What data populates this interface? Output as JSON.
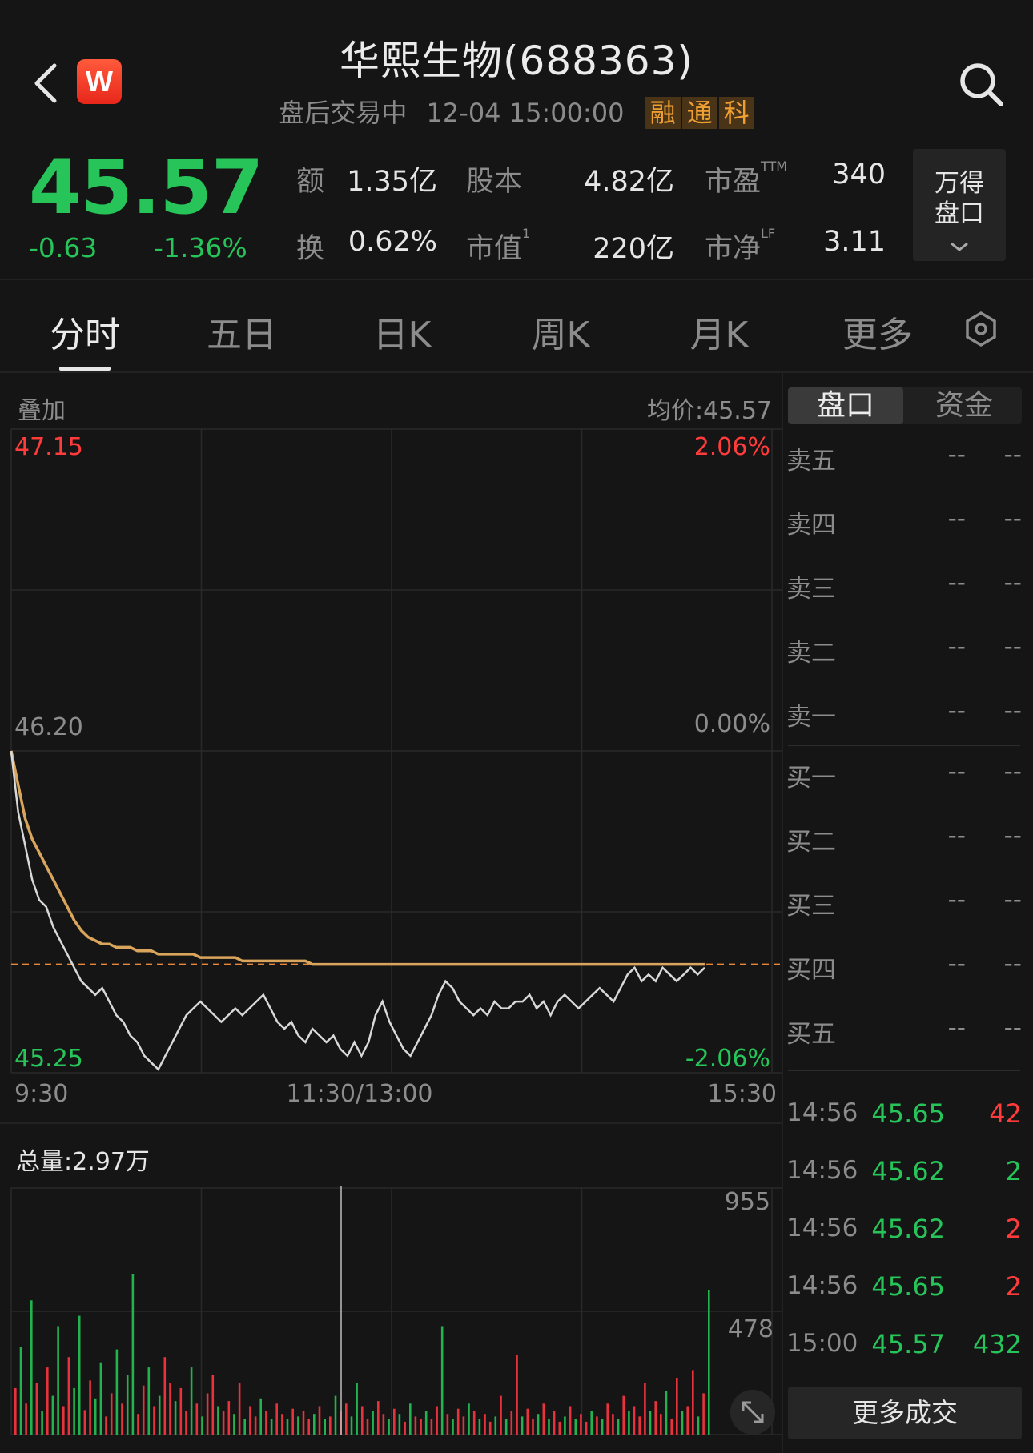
{
  "header": {
    "back_icon": "chevron-left-icon",
    "logo_letter": "W",
    "title": "华熙生物(688363)",
    "status": "盘后交易中",
    "datetime": "12-04 15:00:00",
    "tags": [
      "融",
      "通",
      "科"
    ],
    "search_icon": "search-icon"
  },
  "quote": {
    "price": "45.57",
    "change": "-0.63",
    "change_pct": "-1.36%",
    "stats": [
      {
        "label": "额",
        "sup": "",
        "value": "1.35亿"
      },
      {
        "label": "股本",
        "sup": "",
        "value": "4.82亿"
      },
      {
        "label": "市盈",
        "sup": "TTM",
        "value": "340"
      },
      {
        "label": "换",
        "sup": "",
        "value": "0.62%"
      },
      {
        "label": "市值",
        "sup": "1",
        "value": "220亿"
      },
      {
        "label": "市净",
        "sup": "LF",
        "value": "3.11"
      }
    ],
    "wande_line1": "万得",
    "wande_line2": "盘口",
    "wande_icon": "chevron-down-icon"
  },
  "tabs": [
    "分时",
    "五日",
    "日K",
    "周K",
    "月K",
    "更多"
  ],
  "active_tab": "分时",
  "settings_icon": "gear-hexagon-icon",
  "chart_header": {
    "overlay": "叠加",
    "avg_price": "均价:45.57"
  },
  "chart_data": {
    "type": "line",
    "y_top_price": "47.15",
    "y_mid_price": "46.20",
    "y_bot_price": "45.25",
    "y_top_pct": "2.06%",
    "y_mid_pct": "0.00%",
    "y_bot_pct": "-2.06%",
    "ylim": [
      45.25,
      47.15
    ],
    "prev_close": 46.2,
    "x_labels": [
      "9:30",
      "11:30/13:00",
      "15:30"
    ],
    "series": [
      {
        "name": "price",
        "color": "#d8d8d8",
        "values": [
          46.2,
          46.02,
          45.92,
          45.82,
          45.76,
          45.74,
          45.68,
          45.64,
          45.6,
          45.56,
          45.52,
          45.5,
          45.48,
          45.5,
          45.46,
          45.42,
          45.4,
          45.36,
          45.34,
          45.3,
          45.28,
          45.26,
          45.3,
          45.34,
          45.38,
          45.42,
          45.44,
          45.46,
          45.44,
          45.42,
          45.4,
          45.42,
          45.44,
          45.42,
          45.44,
          45.46,
          45.48,
          45.44,
          45.4,
          45.38,
          45.4,
          45.36,
          45.34,
          45.38,
          45.36,
          45.34,
          45.36,
          45.32,
          45.3,
          45.34,
          45.3,
          45.34,
          45.42,
          45.46,
          45.4,
          45.36,
          45.32,
          45.3,
          45.34,
          45.38,
          45.42,
          45.48,
          45.52,
          45.5,
          45.46,
          45.44,
          45.42,
          45.44,
          45.42,
          45.46,
          45.44,
          45.44,
          45.46,
          45.46,
          45.48,
          45.44,
          45.46,
          45.42,
          45.46,
          45.48,
          45.46,
          45.44,
          45.46,
          45.48,
          45.5,
          45.48,
          45.46,
          45.5,
          45.54,
          45.56,
          45.52,
          45.54,
          45.52,
          45.56,
          45.54,
          45.52,
          45.54,
          45.56,
          45.54,
          45.56
        ]
      },
      {
        "name": "avg",
        "color": "#d9a55c",
        "values": [
          46.2,
          46.1,
          46.0,
          45.94,
          45.9,
          45.86,
          45.82,
          45.78,
          45.74,
          45.7,
          45.67,
          45.65,
          45.64,
          45.63,
          45.63,
          45.62,
          45.62,
          45.62,
          45.61,
          45.61,
          45.61,
          45.6,
          45.6,
          45.6,
          45.6,
          45.6,
          45.6,
          45.59,
          45.59,
          45.59,
          45.59,
          45.59,
          45.59,
          45.58,
          45.58,
          45.58,
          45.58,
          45.58,
          45.58,
          45.58,
          45.58,
          45.58,
          45.58,
          45.57,
          45.57,
          45.57,
          45.57,
          45.57,
          45.57,
          45.57,
          45.57,
          45.57,
          45.57,
          45.57,
          45.57,
          45.57,
          45.57,
          45.57,
          45.57,
          45.57,
          45.57,
          45.57,
          45.57,
          45.57,
          45.57,
          45.57,
          45.57,
          45.57,
          45.57,
          45.57,
          45.57,
          45.57,
          45.57,
          45.57,
          45.57,
          45.57,
          45.57,
          45.57,
          45.57,
          45.57,
          45.57,
          45.57,
          45.57,
          45.57,
          45.57,
          45.57,
          45.57,
          45.57,
          45.57,
          45.57,
          45.57,
          45.57,
          45.57,
          45.57,
          45.57,
          45.57,
          45.57,
          45.57,
          45.57,
          45.57
        ]
      }
    ],
    "grid": true
  },
  "volume": {
    "total_label": "总量:2.97万",
    "y_top": "955",
    "y_mid": "478",
    "ymax": 955,
    "bars": [
      [
        180,
        "r"
      ],
      [
        340,
        "g"
      ],
      [
        120,
        "r"
      ],
      [
        520,
        "g"
      ],
      [
        200,
        "r"
      ],
      [
        90,
        "g"
      ],
      [
        260,
        "r"
      ],
      [
        150,
        "g"
      ],
      [
        420,
        "g"
      ],
      [
        110,
        "r"
      ],
      [
        300,
        "r"
      ],
      [
        180,
        "g"
      ],
      [
        460,
        "g"
      ],
      [
        95,
        "r"
      ],
      [
        210,
        "r"
      ],
      [
        140,
        "g"
      ],
      [
        280,
        "g"
      ],
      [
        70,
        "r"
      ],
      [
        160,
        "r"
      ],
      [
        330,
        "g"
      ],
      [
        120,
        "r"
      ],
      [
        230,
        "g"
      ],
      [
        620,
        "g"
      ],
      [
        80,
        "r"
      ],
      [
        190,
        "r"
      ],
      [
        260,
        "g"
      ],
      [
        110,
        "r"
      ],
      [
        150,
        "g"
      ],
      [
        300,
        "r"
      ],
      [
        200,
        "r"
      ],
      [
        130,
        "g"
      ],
      [
        180,
        "r"
      ],
      [
        90,
        "r"
      ],
      [
        260,
        "g"
      ],
      [
        120,
        "r"
      ],
      [
        70,
        "g"
      ],
      [
        160,
        "r"
      ],
      [
        230,
        "r"
      ],
      [
        110,
        "g"
      ],
      [
        90,
        "r"
      ],
      [
        130,
        "r"
      ],
      [
        80,
        "g"
      ],
      [
        200,
        "r"
      ],
      [
        60,
        "g"
      ],
      [
        110,
        "r"
      ],
      [
        70,
        "r"
      ],
      [
        140,
        "g"
      ],
      [
        90,
        "r"
      ],
      [
        60,
        "g"
      ],
      [
        120,
        "r"
      ],
      [
        80,
        "r"
      ],
      [
        60,
        "g"
      ],
      [
        100,
        "r"
      ],
      [
        70,
        "g"
      ],
      [
        90,
        "r"
      ],
      [
        60,
        "r"
      ],
      [
        80,
        "g"
      ],
      [
        110,
        "r"
      ],
      [
        60,
        "g"
      ],
      [
        70,
        "r"
      ],
      [
        150,
        "g"
      ],
      [
        90,
        "r"
      ],
      [
        120,
        "r"
      ],
      [
        70,
        "g"
      ],
      [
        200,
        "g"
      ],
      [
        110,
        "r"
      ],
      [
        60,
        "r"
      ],
      [
        90,
        "g"
      ],
      [
        130,
        "r"
      ],
      [
        80,
        "r"
      ],
      [
        60,
        "g"
      ],
      [
        100,
        "r"
      ],
      [
        80,
        "g"
      ],
      [
        50,
        "r"
      ],
      [
        120,
        "g"
      ],
      [
        70,
        "r"
      ],
      [
        60,
        "r"
      ],
      [
        90,
        "g"
      ],
      [
        60,
        "r"
      ],
      [
        110,
        "r"
      ],
      [
        420,
        "g"
      ],
      [
        80,
        "r"
      ],
      [
        60,
        "g"
      ],
      [
        100,
        "r"
      ],
      [
        70,
        "r"
      ],
      [
        120,
        "g"
      ],
      [
        90,
        "r"
      ],
      [
        60,
        "g"
      ],
      [
        80,
        "r"
      ],
      [
        50,
        "r"
      ],
      [
        70,
        "g"
      ],
      [
        150,
        "r"
      ],
      [
        60,
        "g"
      ],
      [
        90,
        "r"
      ],
      [
        310,
        "r"
      ],
      [
        70,
        "g"
      ],
      [
        100,
        "r"
      ],
      [
        60,
        "r"
      ],
      [
        80,
        "g"
      ],
      [
        120,
        "r"
      ],
      [
        60,
        "g"
      ],
      [
        90,
        "r"
      ],
      [
        50,
        "r"
      ],
      [
        70,
        "g"
      ],
      [
        110,
        "r"
      ],
      [
        60,
        "g"
      ],
      [
        80,
        "r"
      ],
      [
        50,
        "r"
      ],
      [
        90,
        "g"
      ],
      [
        70,
        "r"
      ],
      [
        60,
        "g"
      ],
      [
        120,
        "r"
      ],
      [
        80,
        "r"
      ],
      [
        60,
        "g"
      ],
      [
        150,
        "r"
      ],
      [
        90,
        "g"
      ],
      [
        110,
        "r"
      ],
      [
        70,
        "r"
      ],
      [
        200,
        "r"
      ],
      [
        90,
        "g"
      ],
      [
        130,
        "r"
      ],
      [
        80,
        "r"
      ],
      [
        170,
        "g"
      ],
      [
        60,
        "r"
      ],
      [
        220,
        "r"
      ],
      [
        90,
        "g"
      ],
      [
        110,
        "r"
      ],
      [
        250,
        "r"
      ],
      [
        70,
        "g"
      ],
      [
        160,
        "r"
      ],
      [
        560,
        "g"
      ]
    ]
  },
  "right_panel": {
    "seg_pankou": "盘口",
    "seg_zijin": "资金",
    "orderbook": [
      {
        "label": "卖五",
        "price": "--",
        "vol": "--"
      },
      {
        "label": "卖四",
        "price": "--",
        "vol": "--"
      },
      {
        "label": "卖三",
        "price": "--",
        "vol": "--"
      },
      {
        "label": "卖二",
        "price": "--",
        "vol": "--"
      },
      {
        "label": "卖一",
        "price": "--",
        "vol": "--"
      },
      {
        "label": "买一",
        "price": "--",
        "vol": "--"
      },
      {
        "label": "买二",
        "price": "--",
        "vol": "--"
      },
      {
        "label": "买三",
        "price": "--",
        "vol": "--"
      },
      {
        "label": "买四",
        "price": "--",
        "vol": "--"
      },
      {
        "label": "买五",
        "price": "--",
        "vol": "--"
      }
    ],
    "trades": [
      {
        "time": "14:56",
        "price": "45.65",
        "vol": "42",
        "dir": "red"
      },
      {
        "time": "14:56",
        "price": "45.62",
        "vol": "2",
        "dir": "green"
      },
      {
        "time": "14:56",
        "price": "45.62",
        "vol": "2",
        "dir": "red"
      },
      {
        "time": "14:56",
        "price": "45.65",
        "vol": "2",
        "dir": "red"
      },
      {
        "time": "15:00",
        "price": "45.57",
        "vol": "432",
        "dir": "green"
      }
    ],
    "more_trades": "更多成交",
    "expand_icon": "expand-arrows-icon"
  },
  "colors": {
    "up": "#ff3b3b",
    "down": "#27c45a",
    "price_line": "#d8d8d8",
    "avg_line": "#d9a55c",
    "grid": "#2a2a2a"
  }
}
